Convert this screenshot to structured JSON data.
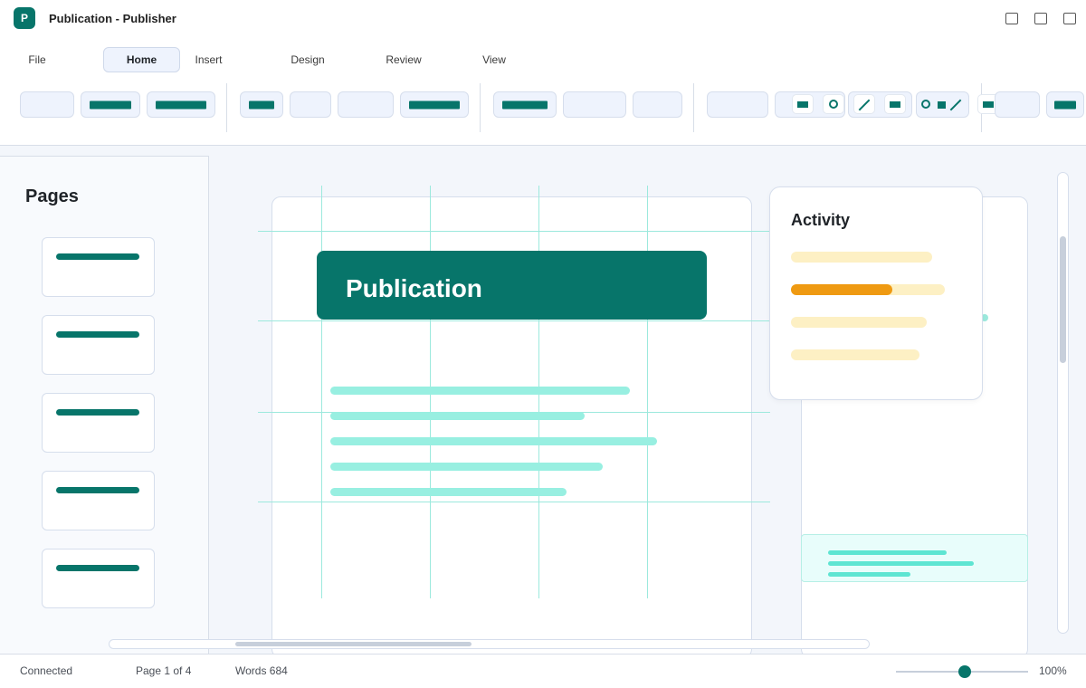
{
  "window": {
    "app_icon_letter": "P",
    "title": "Publication - Publisher"
  },
  "menu": {
    "tabs": [
      {
        "label": "File"
      },
      {
        "label": "Home"
      },
      {
        "label": "Insert"
      },
      {
        "label": "Design"
      },
      {
        "label": "Review"
      },
      {
        "label": "View"
      }
    ],
    "active_tab": "Home"
  },
  "pages_panel": {
    "title": "Pages",
    "page_count": 5
  },
  "document": {
    "banner_title": "Publication"
  },
  "activity": {
    "title": "Activity",
    "progress": [
      0,
      0.66,
      0,
      0
    ]
  },
  "status": {
    "connection": "Connected",
    "page": "Page 1 of 4",
    "words": "Words 684",
    "zoom": "100%"
  },
  "colors": {
    "accent": "#07756a",
    "guide": "#9ce9dd",
    "progress_fill": "#ef9a12",
    "progress_track": "#fdf0c4"
  },
  "icons": {
    "window_buttons": [
      "minimize-icon",
      "maximize-icon",
      "close-icon"
    ],
    "shape_tools": [
      "rectangle-icon",
      "circle-icon",
      "line-icon"
    ]
  }
}
